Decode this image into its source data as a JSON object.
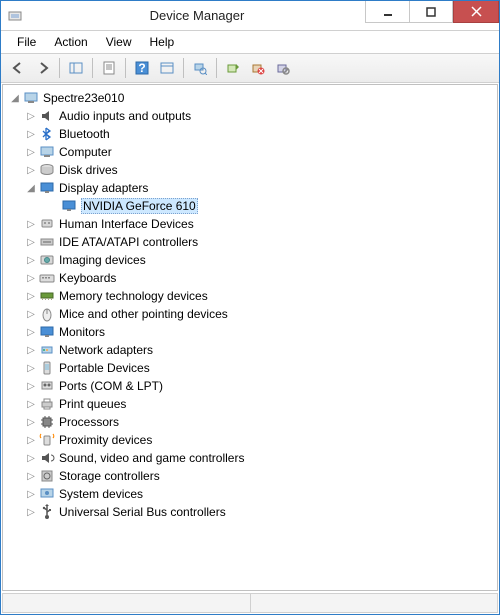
{
  "window": {
    "title": "Device Manager"
  },
  "menu": {
    "file": "File",
    "action": "Action",
    "view": "View",
    "help": "Help"
  },
  "root": {
    "name": "Spectre23e010"
  },
  "cats": [
    {
      "label": "Audio inputs and outputs",
      "icon": "speaker"
    },
    {
      "label": "Bluetooth",
      "icon": "bluetooth"
    },
    {
      "label": "Computer",
      "icon": "computer"
    },
    {
      "label": "Disk drives",
      "icon": "disk"
    },
    {
      "label": "Display adapters",
      "icon": "display",
      "expanded": true,
      "children": [
        {
          "label": "NVIDIA GeForce 610",
          "icon": "display",
          "selected": true
        }
      ]
    },
    {
      "label": "Human Interface Devices",
      "icon": "hid"
    },
    {
      "label": "IDE ATA/ATAPI controllers",
      "icon": "ide"
    },
    {
      "label": "Imaging devices",
      "icon": "imaging"
    },
    {
      "label": "Keyboards",
      "icon": "keyboard"
    },
    {
      "label": "Memory technology devices",
      "icon": "memory"
    },
    {
      "label": "Mice and other pointing devices",
      "icon": "mouse"
    },
    {
      "label": "Monitors",
      "icon": "monitor"
    },
    {
      "label": "Network adapters",
      "icon": "network"
    },
    {
      "label": "Portable Devices",
      "icon": "portable"
    },
    {
      "label": "Ports (COM & LPT)",
      "icon": "ports"
    },
    {
      "label": "Print queues",
      "icon": "printer"
    },
    {
      "label": "Processors",
      "icon": "cpu"
    },
    {
      "label": "Proximity devices",
      "icon": "proximity"
    },
    {
      "label": "Sound, video and game controllers",
      "icon": "sound"
    },
    {
      "label": "Storage controllers",
      "icon": "storage"
    },
    {
      "label": "System devices",
      "icon": "system"
    },
    {
      "label": "Universal Serial Bus controllers",
      "icon": "usb"
    }
  ]
}
